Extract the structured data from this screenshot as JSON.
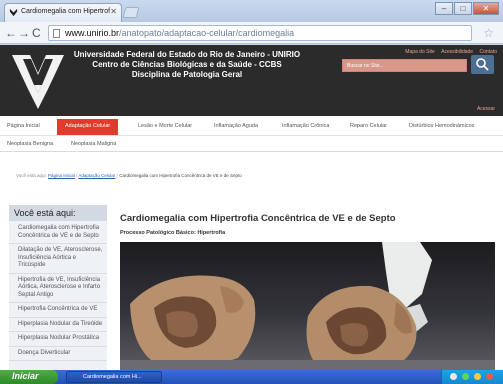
{
  "browser": {
    "tab_title": "Cardiomegalia com Hipertrof",
    "url_host": "www.unirio.br",
    "url_path": "/anatopato/adaptacao-celular/cardiomegalia"
  },
  "header": {
    "university_line1": "Universidade Federal do Estado do Rio de Janeiro - UNIRIO",
    "university_line2": "Centro de Ciências Biológicas e da Saúde - CCBS",
    "university_line3": "Disciplina de Patologia Geral",
    "top_links": [
      "Mapa do Site",
      "Acessibilidade",
      "Contato"
    ],
    "search_placeholder": "Buscar no Site...",
    "acessar_label": "Acessar"
  },
  "nav": {
    "main": [
      "Página Inicial",
      "Adaptação Celular",
      "Lesão e Morte Celular",
      "Inflamação Aguda",
      "Inflamação Crônica",
      "Reparo Celular",
      "Distúrbios Hemodinâmicos"
    ],
    "secondary": [
      "Neoplasia Benigna",
      "Neoplasia Maligna"
    ]
  },
  "breadcrumb": {
    "prefix": "Você está aqui:",
    "home": "Página Inicial",
    "sep1": "/",
    "parent": "Adaptação Celular",
    "sep2": "/",
    "current": "Cardiomegalia com Hipertrofia Concêntrica de VE e de Septo"
  },
  "sidebar": {
    "title": "Você está aqui:",
    "items": [
      "Cardiomegalia com Hipertrofia Concêntrica de VE e de Septo",
      "Dilatação de VE, Aterosclerose, Insuficiência Aórtica e Tricúspide",
      "Hipertrofia de VE, Insuficiência Aórtica, Aterosclerose e Infarto Septal Antigo",
      "Hipertrofia Concêntrica de VE",
      "Hiperplasia Nodular da Tireóide",
      "Hiperplasia Nodular Prostática",
      "Doença Diverticular"
    ]
  },
  "content": {
    "title": "Cardiomegalia com Hipertrofia Concêntrica de VE e de Septo",
    "subtitle": "Processo Patológico Básico: Hipertrofia"
  },
  "taskbar": {
    "start_label": "Iniciar",
    "task_label": "Cardiomegalia com Hi..."
  },
  "colors": {
    "accent_red": "#e23b2e",
    "header_dark": "#2b2b2b",
    "link_blue": "#2b5fb0"
  }
}
